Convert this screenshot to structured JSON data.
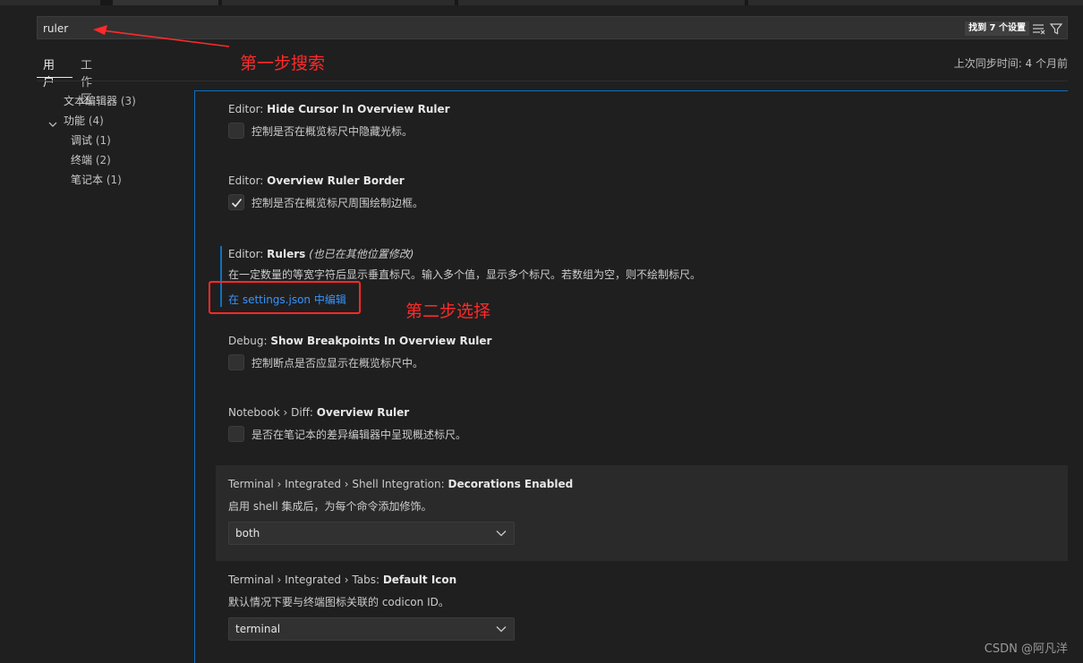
{
  "search": {
    "value": "ruler",
    "result_count": "找到 7 个设置",
    "clear_filter_icon": "list-filter-icon",
    "filter_icon": "funnel-icon"
  },
  "tabs": [
    {
      "label": "用户",
      "active": true
    },
    {
      "label": "工作区",
      "active": false
    }
  ],
  "last_sync": "上次同步时间: 4 个月前",
  "toc": [
    {
      "label": "文本编辑器",
      "count": "(3)"
    },
    {
      "label": "功能",
      "count": "(4)",
      "expanded": true
    },
    {
      "label": "调试",
      "count": "(1)"
    },
    {
      "label": "终端",
      "count": "(2)"
    },
    {
      "label": "笔记本",
      "count": "(1)"
    }
  ],
  "settings": [
    {
      "category": "Editor: ",
      "name": "Hide Cursor In Overview Ruler",
      "type": "checkbox",
      "checked": false,
      "desc": "控制是否在概览标尺中隐藏光标。"
    },
    {
      "category": "Editor: ",
      "name": "Overview Ruler Border",
      "type": "checkbox",
      "checked": true,
      "desc": "控制是否在概览标尺周围绘制边框。"
    },
    {
      "category": "Editor: ",
      "name": "Rulers",
      "note": "(也已在其他位置修改)",
      "desc": "在一定数量的等宽字符后显示垂直标尺。输入多个值，显示多个标尺。若数组为空，则不绘制标尺。",
      "link": "在 settings.json 中编辑"
    },
    {
      "category": "Debug: ",
      "name": "Show Breakpoints In Overview Ruler",
      "type": "checkbox",
      "checked": false,
      "desc": "控制断点是否应显示在概览标尺中。"
    },
    {
      "category": "Notebook › Diff: ",
      "name": "Overview Ruler",
      "type": "checkbox",
      "checked": false,
      "desc": "是否在笔记本的差异编辑器中呈现概述标尺。"
    },
    {
      "category": "Terminal › Integrated › Shell Integration: ",
      "name": "Decorations Enabled",
      "type": "select",
      "value": "both",
      "desc": "启用 shell 集成后，为每个命令添加修饰。"
    },
    {
      "category": "Terminal › Integrated › Tabs: ",
      "name": "Default Icon",
      "type": "select",
      "value": "terminal",
      "desc": "默认情况下要与终端图标关联的 codicon ID。"
    }
  ],
  "annotations": {
    "step1": "第一步搜索",
    "step2": "第二步选择",
    "color": "#ff2a2a"
  },
  "watermark": "CSDN @阿凡洋",
  "colors": {
    "accent": "#0e70c0",
    "link": "#3794ff",
    "background": "#1f1f1f"
  }
}
